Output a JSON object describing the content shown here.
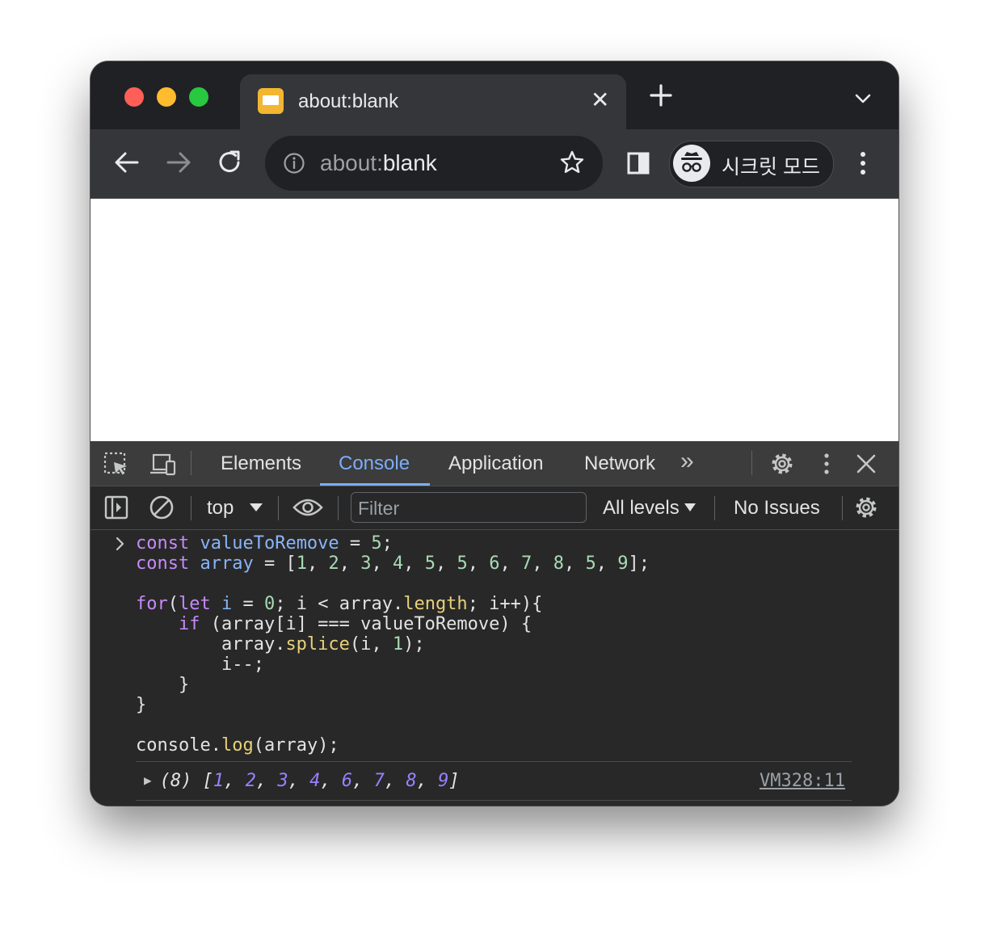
{
  "tab": {
    "title": "about:blank",
    "close_glyph": "✕"
  },
  "omnibox": {
    "url_dim": "about:",
    "url_main": "blank"
  },
  "profile": {
    "incognito_label": "시크릿 모드"
  },
  "devtools": {
    "tabs": [
      {
        "label": "Elements"
      },
      {
        "label": "Console"
      },
      {
        "label": "Application"
      },
      {
        "label": "Network"
      }
    ],
    "overflow_glyph": "»",
    "active_tab": "Console",
    "context": "top",
    "filter_placeholder": "Filter",
    "levels": "All levels",
    "issues": "No Issues"
  },
  "console": {
    "input_prompt": "›",
    "result_prefix": "(8) [",
    "result_values": [
      "1",
      "2",
      "3",
      "4",
      "6",
      "7",
      "8",
      "9"
    ],
    "result_suffix": "]",
    "source_link": "VM328:11"
  },
  "colors": {
    "accent": "#7cacf8",
    "keyword": "#c58af9",
    "number": "#a8dab5",
    "property": "#e7d07a",
    "array_value": "#9980ff"
  }
}
